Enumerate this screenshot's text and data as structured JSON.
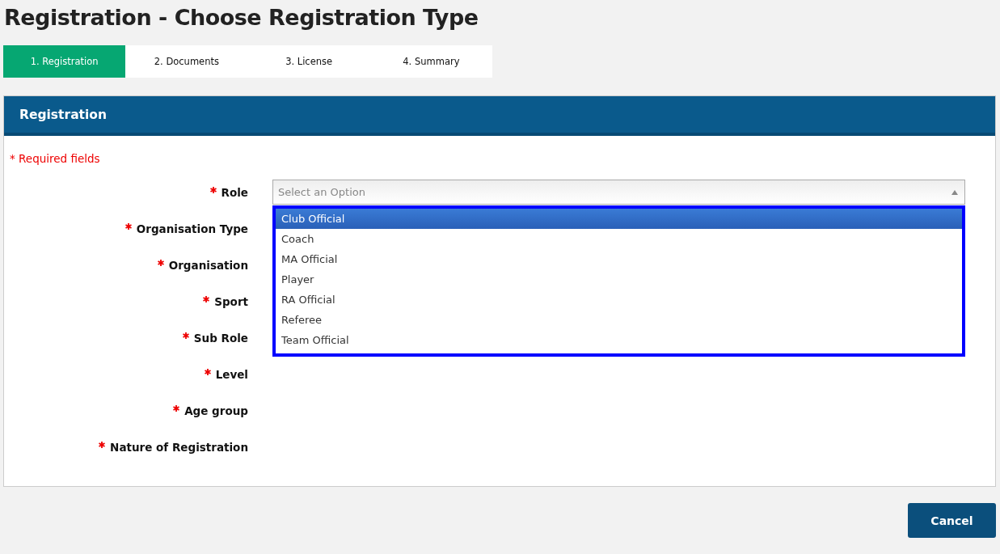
{
  "page_title": "Registration - Choose Registration Type",
  "steps": [
    {
      "label": "1. Registration",
      "selected": true
    },
    {
      "label": "2. Documents",
      "selected": false
    },
    {
      "label": "3. License",
      "selected": false
    },
    {
      "label": "4. Summary",
      "selected": false
    }
  ],
  "panel": {
    "title": "Registration",
    "required_note": {
      "mark": "*",
      "text": "Required fields"
    },
    "fields": [
      {
        "label": "Role",
        "required": true,
        "kind": "select",
        "placeholder": "Select an Option",
        "expanded": true,
        "options": [
          {
            "label": "Club Official",
            "selected": true
          },
          {
            "label": "Coach",
            "selected": false
          },
          {
            "label": "MA Official",
            "selected": false
          },
          {
            "label": "Player",
            "selected": false
          },
          {
            "label": "RA Official",
            "selected": false
          },
          {
            "label": "Referee",
            "selected": false
          },
          {
            "label": "Team Official",
            "selected": false
          }
        ]
      },
      {
        "label": "Organisation Type",
        "required": true,
        "kind": "label"
      },
      {
        "label": "Organisation",
        "required": true,
        "kind": "label"
      },
      {
        "label": "Sport",
        "required": true,
        "kind": "label"
      },
      {
        "label": "Sub Role",
        "required": true,
        "kind": "label"
      },
      {
        "label": "Level",
        "required": true,
        "kind": "label"
      },
      {
        "label": "Age group",
        "required": true,
        "kind": "label"
      },
      {
        "label": "Nature of Registration",
        "required": true,
        "kind": "label"
      }
    ]
  },
  "buttons": [
    {
      "label": "Cancel"
    }
  ]
}
